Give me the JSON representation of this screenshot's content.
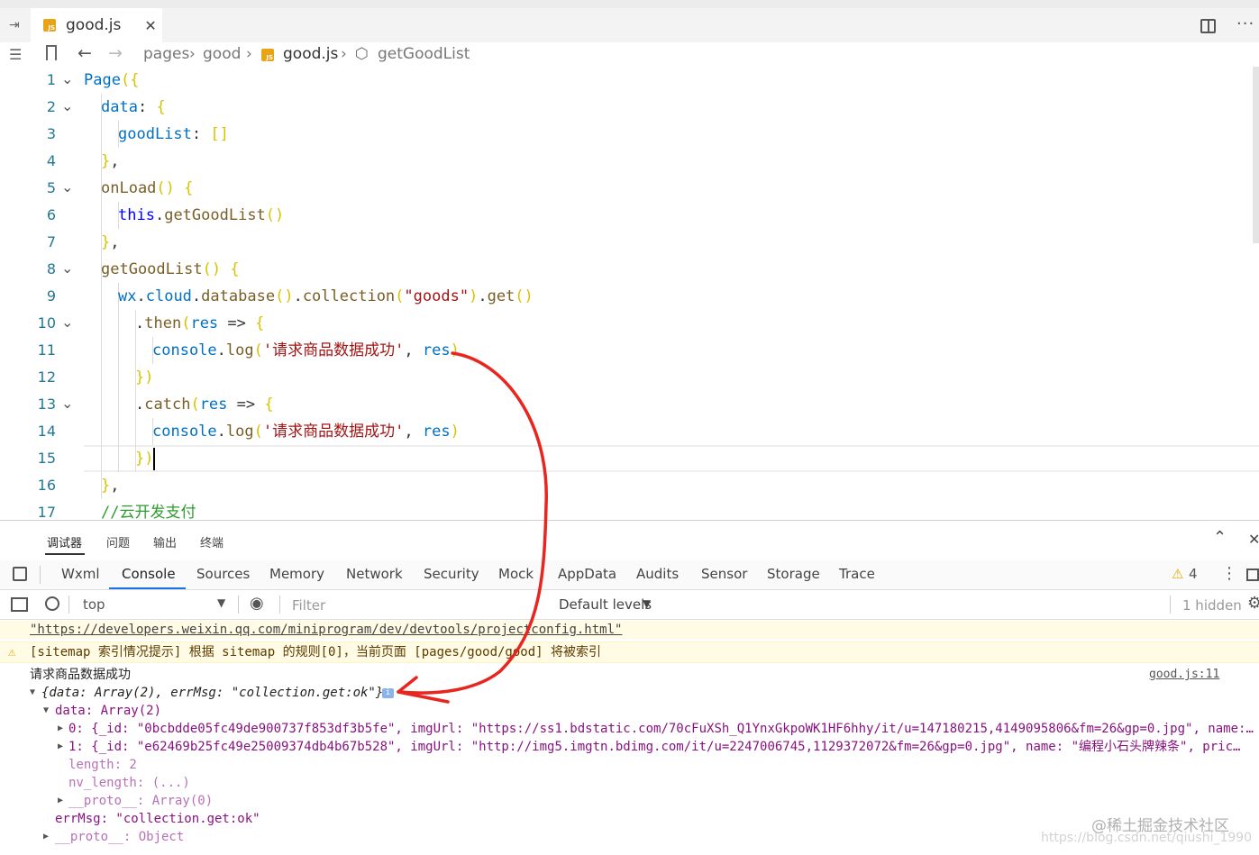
{
  "editor": {
    "tab_label": "good.js",
    "breadcrumb": [
      "pages",
      "good",
      "good.js",
      "getGoodList"
    ],
    "lines": [
      {
        "n": "1",
        "text": "Page({"
      },
      {
        "n": "2",
        "text": "data: {"
      },
      {
        "n": "3",
        "text": "goodList: []"
      },
      {
        "n": "4",
        "text": "},"
      },
      {
        "n": "5",
        "text": "onLoad() {"
      },
      {
        "n": "6",
        "text": "this.getGoodList()"
      },
      {
        "n": "7",
        "text": "},"
      },
      {
        "n": "8",
        "text": "getGoodList() {"
      },
      {
        "n": "9",
        "text": "wx.cloud.database().collection(\"goods\").get()"
      },
      {
        "n": "10",
        "text": ".then(res => {"
      },
      {
        "n": "11",
        "text": "console.log('请求商品数据成功', res)"
      },
      {
        "n": "12",
        "text": "})"
      },
      {
        "n": "13",
        "text": ".catch(res => {"
      },
      {
        "n": "14",
        "text": "console.log('请求商品数据成功', res)"
      },
      {
        "n": "15",
        "text": "})"
      },
      {
        "n": "16",
        "text": "},"
      },
      {
        "n": "17",
        "text": "//云开发支付"
      }
    ]
  },
  "panel": {
    "tabs": [
      "调试器",
      "问题",
      "输出",
      "终端"
    ]
  },
  "devtools": {
    "tabs": [
      "Wxml",
      "Console",
      "Sources",
      "Memory",
      "Network",
      "Security",
      "Mock",
      "AppData",
      "Audits",
      "Sensor",
      "Storage",
      "Trace"
    ],
    "active_tab": "Console",
    "warning_count": "4"
  },
  "console_bar": {
    "context": "top",
    "filter_placeholder": "Filter",
    "levels": "Default levels",
    "hidden": "1 hidden"
  },
  "console": {
    "link_line": "\"https://developers.weixin.qq.com/miniprogram/dev/devtools/projectconfig.html\"",
    "warning_line": "[sitemap 索引情况提示] 根据 sitemap 的规则[0]，当前页面 [pages/good/good] 将被索引",
    "log_message": "请求商品数据成功",
    "log_source": "good.js:11",
    "obj_summary": "{data: Array(2), errMsg: \"collection.get:ok\"}",
    "data_line": "data: Array(2)",
    "item0": "0: {_id: \"0bcbdde05fc49de900737f853df3b5fe\", imgUrl: \"https://ss1.bdstatic.com/70cFuXSh_Q1YnxGkpoWK1HF6hhy/it/u=147180215,4149095806&fm=26&gp=0.jpg\", name:…",
    "item1": "1: {_id: \"e62469b25fc49e25009374db4b67b528\", imgUrl: \"http://img5.imgtn.bdimg.com/it/u=2247006745,1129372072&fm=26&gp=0.jpg\", name: \"编程小石头牌辣条\", pric…",
    "length_line": "length: 2",
    "nvlength_line": "nv_length: (...)",
    "proto_arr": "__proto__: Array(0)",
    "errmsg_line": "errMsg: \"collection.get:ok\"",
    "proto_obj": "__proto__: Object"
  },
  "watermark": {
    "line1": "@稀土掘金技术社区",
    "line2": "https://blog.csdn.net/qiushi_1990"
  },
  "annotation_color": "#e8251f"
}
